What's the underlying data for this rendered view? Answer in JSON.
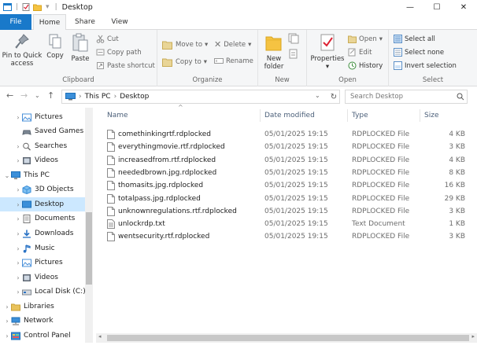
{
  "window": {
    "title": "Desktop",
    "minimize_glyph": "—",
    "maximize_glyph": "☐",
    "close_glyph": "✕"
  },
  "ribbon_tabs": [
    "File",
    "Home",
    "Share",
    "View"
  ],
  "ribbon": {
    "clipboard": {
      "label": "Clipboard",
      "pin": "Pin to Quick access",
      "copy": "Copy",
      "paste": "Paste",
      "cut": "Cut",
      "copy_path": "Copy path",
      "paste_shortcut": "Paste shortcut"
    },
    "organize": {
      "label": "Organize",
      "move_to": "Move to",
      "copy_to": "Copy to",
      "delete": "Delete",
      "rename": "Rename"
    },
    "new": {
      "label": "New",
      "new_folder": "New folder"
    },
    "open": {
      "label": "Open",
      "properties": "Properties",
      "open": "Open",
      "edit": "Edit",
      "history": "History"
    },
    "select": {
      "label": "Select",
      "select_all": "Select all",
      "select_none": "Select none",
      "invert": "Invert selection"
    }
  },
  "address": {
    "crumbs": [
      "This PC",
      "Desktop"
    ],
    "search_placeholder": "Search Desktop"
  },
  "nav": [
    {
      "label": "Pictures",
      "icon": "pictures-icon",
      "chevron": "›",
      "selected": false
    },
    {
      "label": "Saved Games",
      "icon": "saved-games-icon",
      "chevron": "",
      "selected": false
    },
    {
      "label": "Searches",
      "icon": "searches-icon",
      "chevron": "›",
      "selected": false
    },
    {
      "label": "Videos",
      "icon": "videos-icon",
      "chevron": "›",
      "selected": false
    },
    {
      "label": "This PC",
      "icon": "this-pc-icon",
      "chevron": "⌄",
      "selected": false
    },
    {
      "label": "3D Objects",
      "icon": "3d-objects-icon",
      "chevron": "›",
      "selected": false
    },
    {
      "label": "Desktop",
      "icon": "desktop-icon",
      "chevron": "›",
      "selected": true
    },
    {
      "label": "Documents",
      "icon": "documents-icon",
      "chevron": "›",
      "selected": false
    },
    {
      "label": "Downloads",
      "icon": "downloads-icon",
      "chevron": "›",
      "selected": false
    },
    {
      "label": "Music",
      "icon": "music-icon",
      "chevron": "›",
      "selected": false
    },
    {
      "label": "Pictures",
      "icon": "pictures-icon",
      "chevron": "›",
      "selected": false
    },
    {
      "label": "Videos",
      "icon": "videos-icon",
      "chevron": "›",
      "selected": false
    },
    {
      "label": "Local Disk (C:)",
      "icon": "local-disk-icon",
      "chevron": "›",
      "selected": false
    },
    {
      "label": "Libraries",
      "icon": "libraries-icon",
      "chevron": "›",
      "selected": false
    },
    {
      "label": "Network",
      "icon": "network-icon",
      "chevron": "›",
      "selected": false
    },
    {
      "label": "Control Panel",
      "icon": "control-panel-icon",
      "chevron": "›",
      "selected": false
    }
  ],
  "columns": {
    "name": "Name",
    "date": "Date modified",
    "type": "Type",
    "size": "Size"
  },
  "files": [
    {
      "name": "comethinkingrtf.rdplocked",
      "date": "05/01/2025 19:15",
      "type": "RDPLOCKED File",
      "size": "4 KB"
    },
    {
      "name": "everythingmovie.rtf.rdplocked",
      "date": "05/01/2025 19:15",
      "type": "RDPLOCKED File",
      "size": "3 KB"
    },
    {
      "name": "increasedfrom.rtf.rdplocked",
      "date": "05/01/2025 19:15",
      "type": "RDPLOCKED File",
      "size": "4 KB"
    },
    {
      "name": "neededbrown.jpg.rdplocked",
      "date": "05/01/2025 19:15",
      "type": "RDPLOCKED File",
      "size": "8 KB"
    },
    {
      "name": "thomasits.jpg.rdplocked",
      "date": "05/01/2025 19:15",
      "type": "RDPLOCKED File",
      "size": "16 KB"
    },
    {
      "name": "totalpass.jpg.rdplocked",
      "date": "05/01/2025 19:15",
      "type": "RDPLOCKED File",
      "size": "29 KB"
    },
    {
      "name": "unknownregulations.rtf.rdplocked",
      "date": "05/01/2025 19:15",
      "type": "RDPLOCKED File",
      "size": "3 KB"
    },
    {
      "name": "unlockrdp.txt",
      "date": "05/01/2025 19:15",
      "type": "Text Document",
      "size": "1 KB"
    },
    {
      "name": "wentsecurity.rtf.rdplocked",
      "date": "05/01/2025 19:15",
      "type": "RDPLOCKED File",
      "size": "3 KB"
    }
  ],
  "colors": {
    "file_tab": "#1979ca",
    "selection": "#cce8ff",
    "folder": "#f5c342"
  }
}
